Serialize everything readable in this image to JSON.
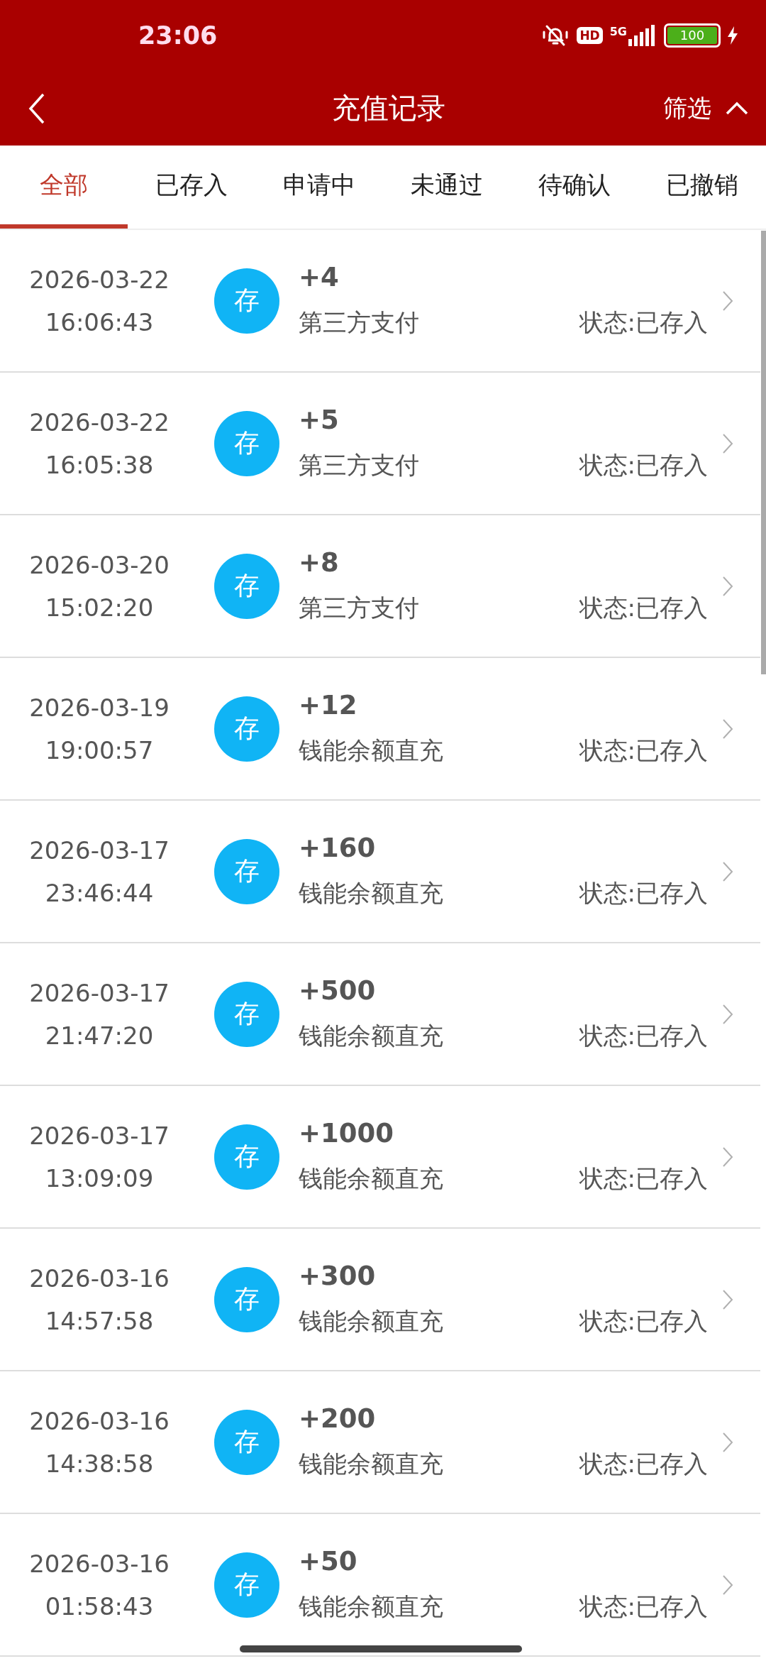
{
  "status_bar": {
    "time": "23:06",
    "hd": "HD",
    "network": "5G",
    "battery": "100"
  },
  "header": {
    "title": "充值记录",
    "filter": "筛选",
    "filter_expanded": true
  },
  "tabs": [
    {
      "label": "全部",
      "selected": true
    },
    {
      "label": "已存入",
      "selected": false
    },
    {
      "label": "申请中",
      "selected": false
    },
    {
      "label": "未通过",
      "selected": false
    },
    {
      "label": "待确认",
      "selected": false
    },
    {
      "label": "已撤销",
      "selected": false
    }
  ],
  "records": [
    {
      "date": "2026-03-22",
      "time": "16:06:43",
      "badge": "存",
      "amount": "+4",
      "method": "第三方支付",
      "status": "状态:已存入"
    },
    {
      "date": "2026-03-22",
      "time": "16:05:38",
      "badge": "存",
      "amount": "+5",
      "method": "第三方支付",
      "status": "状态:已存入"
    },
    {
      "date": "2026-03-20",
      "time": "15:02:20",
      "badge": "存",
      "amount": "+8",
      "method": "第三方支付",
      "status": "状态:已存入"
    },
    {
      "date": "2026-03-19",
      "time": "19:00:57",
      "badge": "存",
      "amount": "+12",
      "method": "钱能余额直充",
      "status": "状态:已存入"
    },
    {
      "date": "2026-03-17",
      "time": "23:46:44",
      "badge": "存",
      "amount": "+160",
      "method": "钱能余额直充",
      "status": "状态:已存入"
    },
    {
      "date": "2026-03-17",
      "time": "21:47:20",
      "badge": "存",
      "amount": "+500",
      "method": "钱能余额直充",
      "status": "状态:已存入"
    },
    {
      "date": "2026-03-17",
      "time": "13:09:09",
      "badge": "存",
      "amount": "+1000",
      "method": "钱能余额直充",
      "status": "状态:已存入"
    },
    {
      "date": "2026-03-16",
      "time": "14:57:58",
      "badge": "存",
      "amount": "+300",
      "method": "钱能余额直充",
      "status": "状态:已存入"
    },
    {
      "date": "2026-03-16",
      "time": "14:38:58",
      "badge": "存",
      "amount": "+200",
      "method": "钱能余额直充",
      "status": "状态:已存入"
    },
    {
      "date": "2026-03-16",
      "time": "01:58:43",
      "badge": "存",
      "amount": "+50",
      "method": "钱能余额直充",
      "status": "状态:已存入"
    }
  ]
}
